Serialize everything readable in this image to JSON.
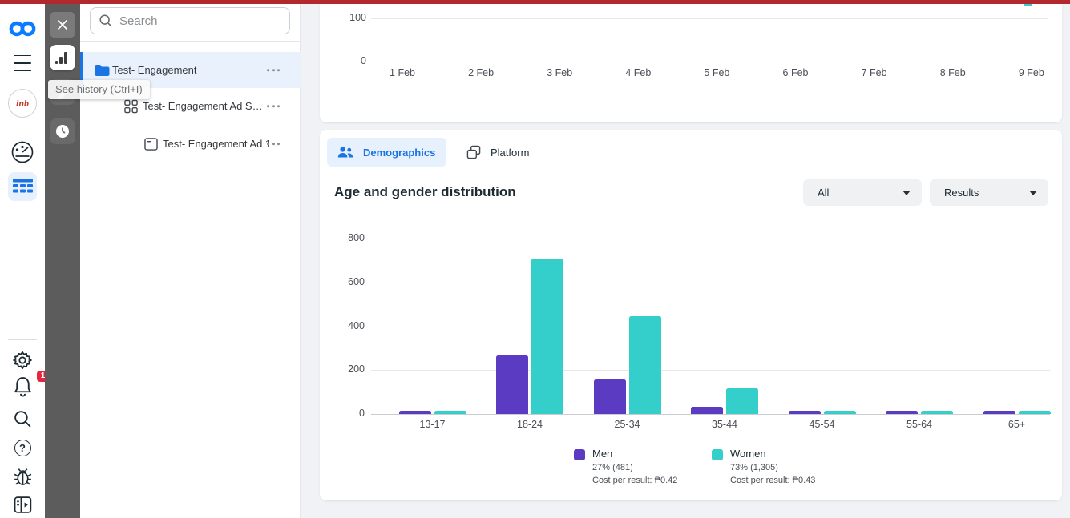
{
  "colors": {
    "brand_blue": "#1b74e4",
    "alert_strip": "#b2282d",
    "badge_red": "#e8243f",
    "men": "#5b3bc2",
    "women": "#34cfca"
  },
  "sidebar": {
    "notification_badge": "1",
    "avatar_label": "inb"
  },
  "toolbar": {
    "tooltip": "See history (Ctrl+I)"
  },
  "panel": {
    "search_placeholder": "Search",
    "tree": [
      {
        "label": "Test- Engagement",
        "level": "campaign",
        "selected": true
      },
      {
        "label": "Test- Engagement Ad Se…",
        "level": "adset",
        "selected": false
      },
      {
        "label": "Test- Engagement Ad 1",
        "level": "ad",
        "selected": false
      }
    ]
  },
  "main": {
    "tabs": [
      {
        "label": "Demographics",
        "active": true
      },
      {
        "label": "Platform",
        "active": false
      }
    ],
    "section_title": "Age and gender distribution",
    "filters": {
      "breakdown": "All",
      "metric": "Results"
    },
    "legend": [
      {
        "name": "Men",
        "share": "27% (481)",
        "cost": "Cost per result: ₱0.42"
      },
      {
        "name": "Women",
        "share": "73% (1,305)",
        "cost": "Cost per result: ₱0.43"
      }
    ]
  },
  "chart_data": [
    {
      "type": "line",
      "title": "",
      "x": [
        "1 Feb",
        "2 Feb",
        "3 Feb",
        "4 Feb",
        "5 Feb",
        "6 Feb",
        "7 Feb",
        "8 Feb",
        "9 Feb"
      ],
      "series": [],
      "yticks": [
        0,
        100
      ],
      "ylim": [
        0,
        100
      ],
      "grid": true
    },
    {
      "type": "bar",
      "title": "Age and gender distribution",
      "categories": [
        "13-17",
        "18-24",
        "25-34",
        "35-44",
        "45-54",
        "55-64",
        "65+"
      ],
      "series": [
        {
          "name": "Men",
          "color": "#5b3bc2",
          "values": [
            14,
            266,
            157,
            34,
            13,
            15,
            15
          ]
        },
        {
          "name": "Women",
          "color": "#34cfca",
          "values": [
            14,
            710,
            447,
            117,
            13,
            13,
            13
          ]
        }
      ],
      "yticks": [
        0,
        200,
        400,
        600,
        800
      ],
      "ylim": [
        0,
        800
      ],
      "grid": true,
      "legend_position": "bottom"
    }
  ]
}
